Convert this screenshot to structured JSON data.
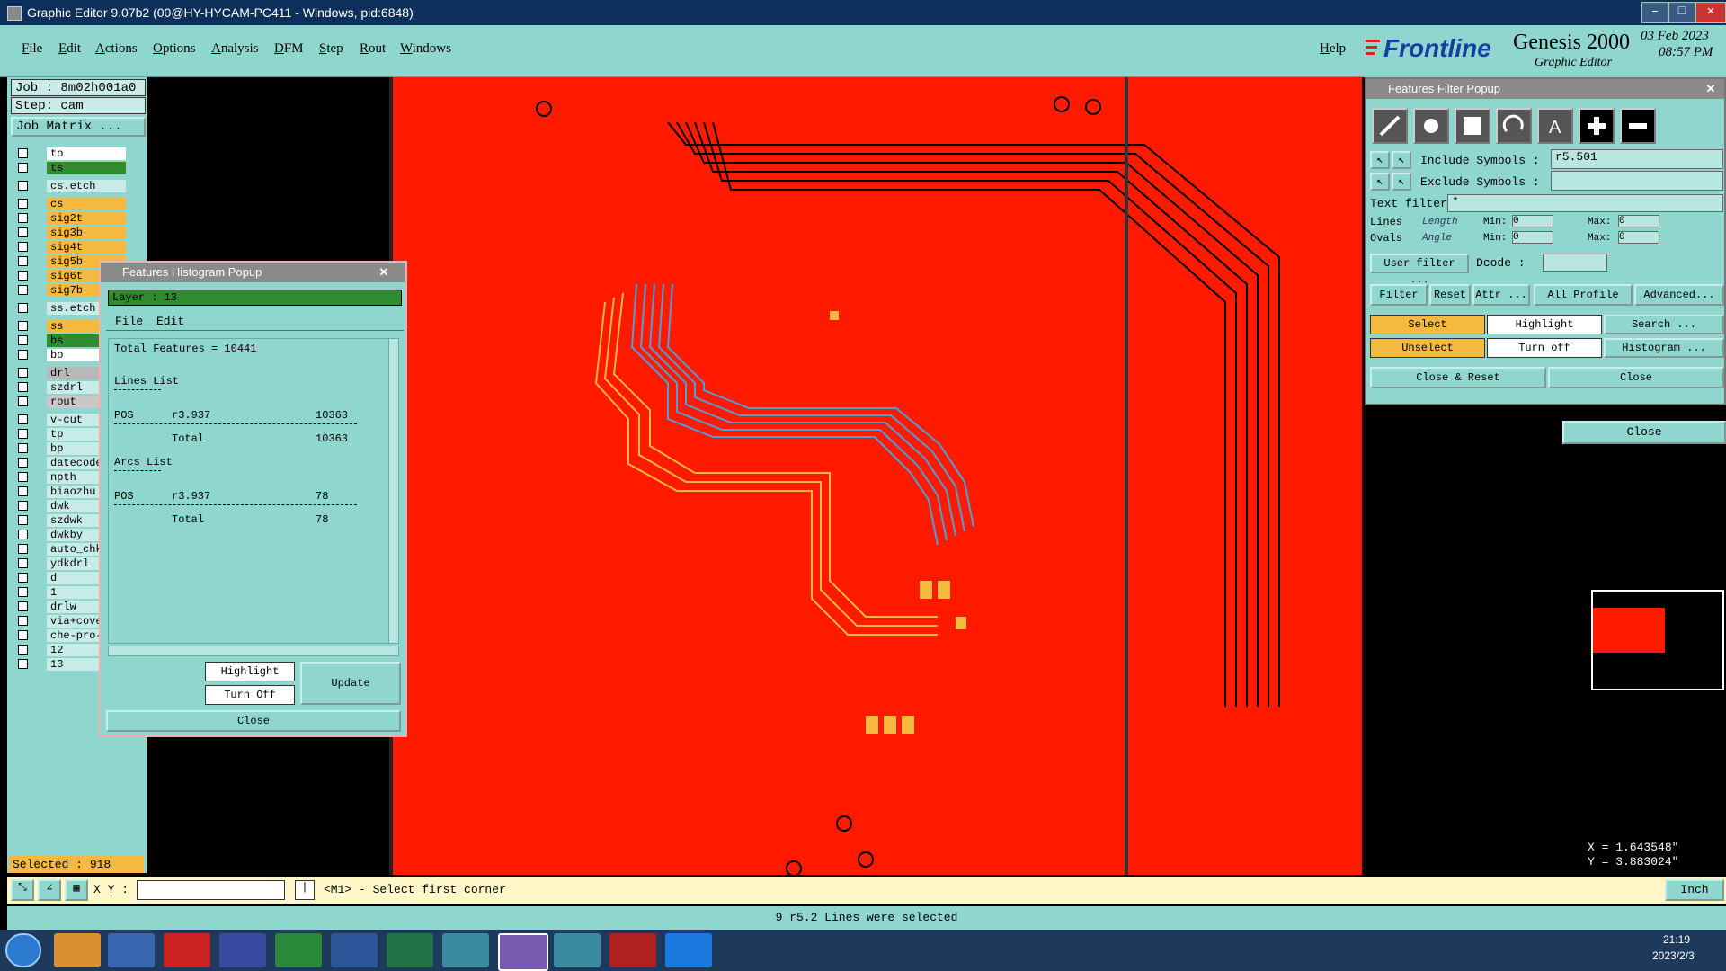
{
  "window": {
    "title": "Graphic Editor 9.07b2 (00@HY-HYCAM-PC411 - Windows, pid:6848)",
    "controls": [
      "–",
      "□",
      "✕"
    ]
  },
  "menu": {
    "items": [
      "File",
      "Edit",
      "Actions",
      "Options",
      "Analysis",
      "DFM",
      "Step",
      "Rout",
      "Windows"
    ],
    "help": "Help"
  },
  "brand": {
    "logo": "Frontline",
    "product": "Genesis 2000",
    "subtitle": "Graphic Editor",
    "date": "03 Feb 2023",
    "time": "08:57 PM"
  },
  "job": {
    "job": "Job : 8m02h001a0",
    "step": "Step: cam",
    "matrix_button": "Job Matrix ..."
  },
  "layers": [
    {
      "name": "to",
      "color": "#ffffff",
      "arrow": true
    },
    {
      "name": "ts",
      "color": "#2e8b2e",
      "arrow": true
    },
    {
      "name": "cs.etch",
      "color": "#c8ebe7",
      "arrow": false
    },
    {
      "name": "cs",
      "color": "#f5b940",
      "arrow": true
    },
    {
      "name": "sig2t",
      "color": "#f5b940",
      "arrow": true
    },
    {
      "name": "sig3b",
      "color": "#f5b940",
      "arrow": false
    },
    {
      "name": "sig4t",
      "color": "#f5b940",
      "arrow": true
    },
    {
      "name": "sig5b",
      "color": "#f5b940",
      "arrow": false
    },
    {
      "name": "sig6t",
      "color": "#f5b940",
      "arrow": false
    },
    {
      "name": "sig7b",
      "color": "#f5b940",
      "arrow": false
    },
    {
      "name": "ss.etch",
      "color": "#c8ebe7",
      "arrow": false
    },
    {
      "name": "ss",
      "color": "#f5b940",
      "arrow": false
    },
    {
      "name": "bs",
      "color": "#2e8b2e",
      "arrow": false
    },
    {
      "name": "bo",
      "color": "#ffffff",
      "arrow": false
    },
    {
      "name": "drl",
      "color": "#b8b8b8",
      "arrow": false
    },
    {
      "name": "szdrl",
      "color": "#c8ebe7",
      "arrow": false
    },
    {
      "name": "rout",
      "color": "#c8c8c8",
      "arrow": false
    },
    {
      "name": "v-cut",
      "color": "#c8ebe7",
      "arrow": false
    },
    {
      "name": "tp",
      "color": "#c8ebe7",
      "arrow": false
    },
    {
      "name": "bp",
      "color": "#c8ebe7",
      "arrow": false
    },
    {
      "name": "datecode",
      "color": "#c8ebe7",
      "arrow": false
    },
    {
      "name": "npth",
      "color": "#c8ebe7",
      "arrow": false
    },
    {
      "name": "biaozhu",
      "color": "#c8ebe7",
      "arrow": false
    },
    {
      "name": "dwk",
      "color": "#c8ebe7",
      "arrow": false
    },
    {
      "name": "szdwk",
      "color": "#c8ebe7",
      "arrow": false
    },
    {
      "name": "dwkby",
      "color": "#c8ebe7",
      "arrow": false
    },
    {
      "name": "auto_chk",
      "color": "#c8ebe7",
      "arrow": false
    },
    {
      "name": "ydkdrl",
      "color": "#c8ebe7",
      "arrow": false
    },
    {
      "name": "d",
      "color": "#c8ebe7",
      "arrow": false
    },
    {
      "name": "1",
      "color": "#c8ebe7",
      "arrow": false
    },
    {
      "name": "drlw",
      "color": "#c8ebe7",
      "arrow": false
    },
    {
      "name": "via+cove",
      "color": "#c8ebe7",
      "arrow": false
    },
    {
      "name": "che-pro-c",
      "color": "#c8ebe7",
      "arrow": false
    },
    {
      "name": "12",
      "color": "#c8ebe7",
      "arrow": false
    },
    {
      "name": "13",
      "color": "#c8ebe7",
      "arrow": false
    }
  ],
  "selected_count": "Selected : 918",
  "histogram": {
    "title": "Features Histogram Popup",
    "layer": "Layer :  13",
    "menu": [
      "File",
      "Edit"
    ],
    "total": "Total Features = 10441",
    "lines_header": "Lines List",
    "lines_rows": [
      [
        "POS",
        "r3.937",
        "10363"
      ]
    ],
    "lines_total": [
      "Total",
      "10363"
    ],
    "arcs_header": "Arcs List",
    "arcs_rows": [
      [
        "POS",
        "r3.937",
        "78"
      ]
    ],
    "arcs_total": [
      "Total",
      "78"
    ],
    "buttons": {
      "highlight": "Highlight",
      "turn_off": "Turn Off",
      "update": "Update",
      "close": "Close"
    }
  },
  "filter": {
    "title": "Features Filter Popup",
    "include_label": "Include Symbols :",
    "include_value": "r5.501",
    "exclude_label": "Exclude Symbols :",
    "exclude_value": "",
    "text_filter_label": "Text filter",
    "text_filter_value": "*",
    "lines_label": "Lines",
    "ovals_label": "Ovals",
    "length_label": "Length",
    "angle_label": "Angle",
    "min_label": "Min:",
    "max_label": "Max:",
    "zero": "0",
    "user_filter": "User filter ...",
    "dcode_label": "Dcode :",
    "filter_btn": "Filter",
    "reset_btn": "Reset",
    "attr_btn": "Attr ...",
    "profile_btn": "All Profile",
    "advanced_btn": "Advanced...",
    "select_btn": "Select",
    "highlight_btn": "Highlight",
    "search_btn": "Search ...",
    "unselect_btn": "Unselect",
    "turnoff_btn": "Turn off",
    "histogram_btn": "Histogram ...",
    "close_reset_btn": "Close & Reset",
    "close_btn": "Close",
    "outer_close_btn": "Close"
  },
  "coords": {
    "x": "X = 1.643548\"",
    "y": "Y = 3.883024\""
  },
  "command": {
    "xy_label": "X Y :",
    "xy_value": "",
    "prompt": "<M1> - Select first corner",
    "unit": "Inch"
  },
  "status": "9 r5.2 Lines were selected",
  "taskbar": {
    "time": "21:19",
    "date": "2023/2/3"
  },
  "colors": {
    "board": "#ff1a00",
    "teal_ui": "#8fd6cf",
    "orange": "#f5b940",
    "trace_blue": "#4aa0d8"
  }
}
